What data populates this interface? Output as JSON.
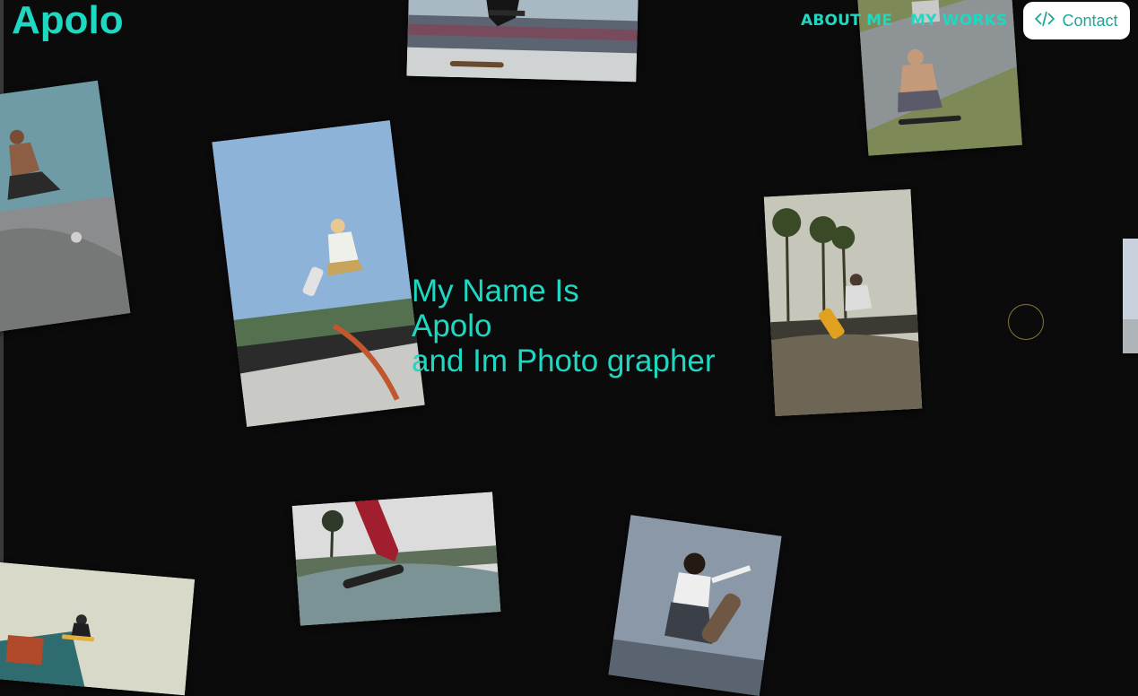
{
  "header": {
    "logo": "Apolo",
    "nav": [
      {
        "label": "ABOUT ME"
      },
      {
        "label": "MY WORKS"
      }
    ],
    "contact_label": "Contact"
  },
  "hero": {
    "line1": "My Name Is",
    "line2": "Apolo",
    "line3": "and Im Photo grapher"
  },
  "colors": {
    "accent": "#1fd8c2",
    "background": "#0b0b0b",
    "contact_bg": "#ffffff"
  },
  "icons": {
    "contact": "code-brackets-icon"
  },
  "gallery": [
    {
      "subject": "skater-ollie-crowd"
    },
    {
      "subject": "longboarder-street"
    },
    {
      "subject": "skatepark-bowl-beach"
    },
    {
      "subject": "skater-air-blue-sky"
    },
    {
      "subject": "skater-bowl-palms"
    },
    {
      "subject": "edge-photo"
    },
    {
      "subject": "skateboard-trick-red-pants"
    },
    {
      "subject": "skater-kickflip-sky"
    },
    {
      "subject": "skater-ramp-jump"
    }
  ]
}
